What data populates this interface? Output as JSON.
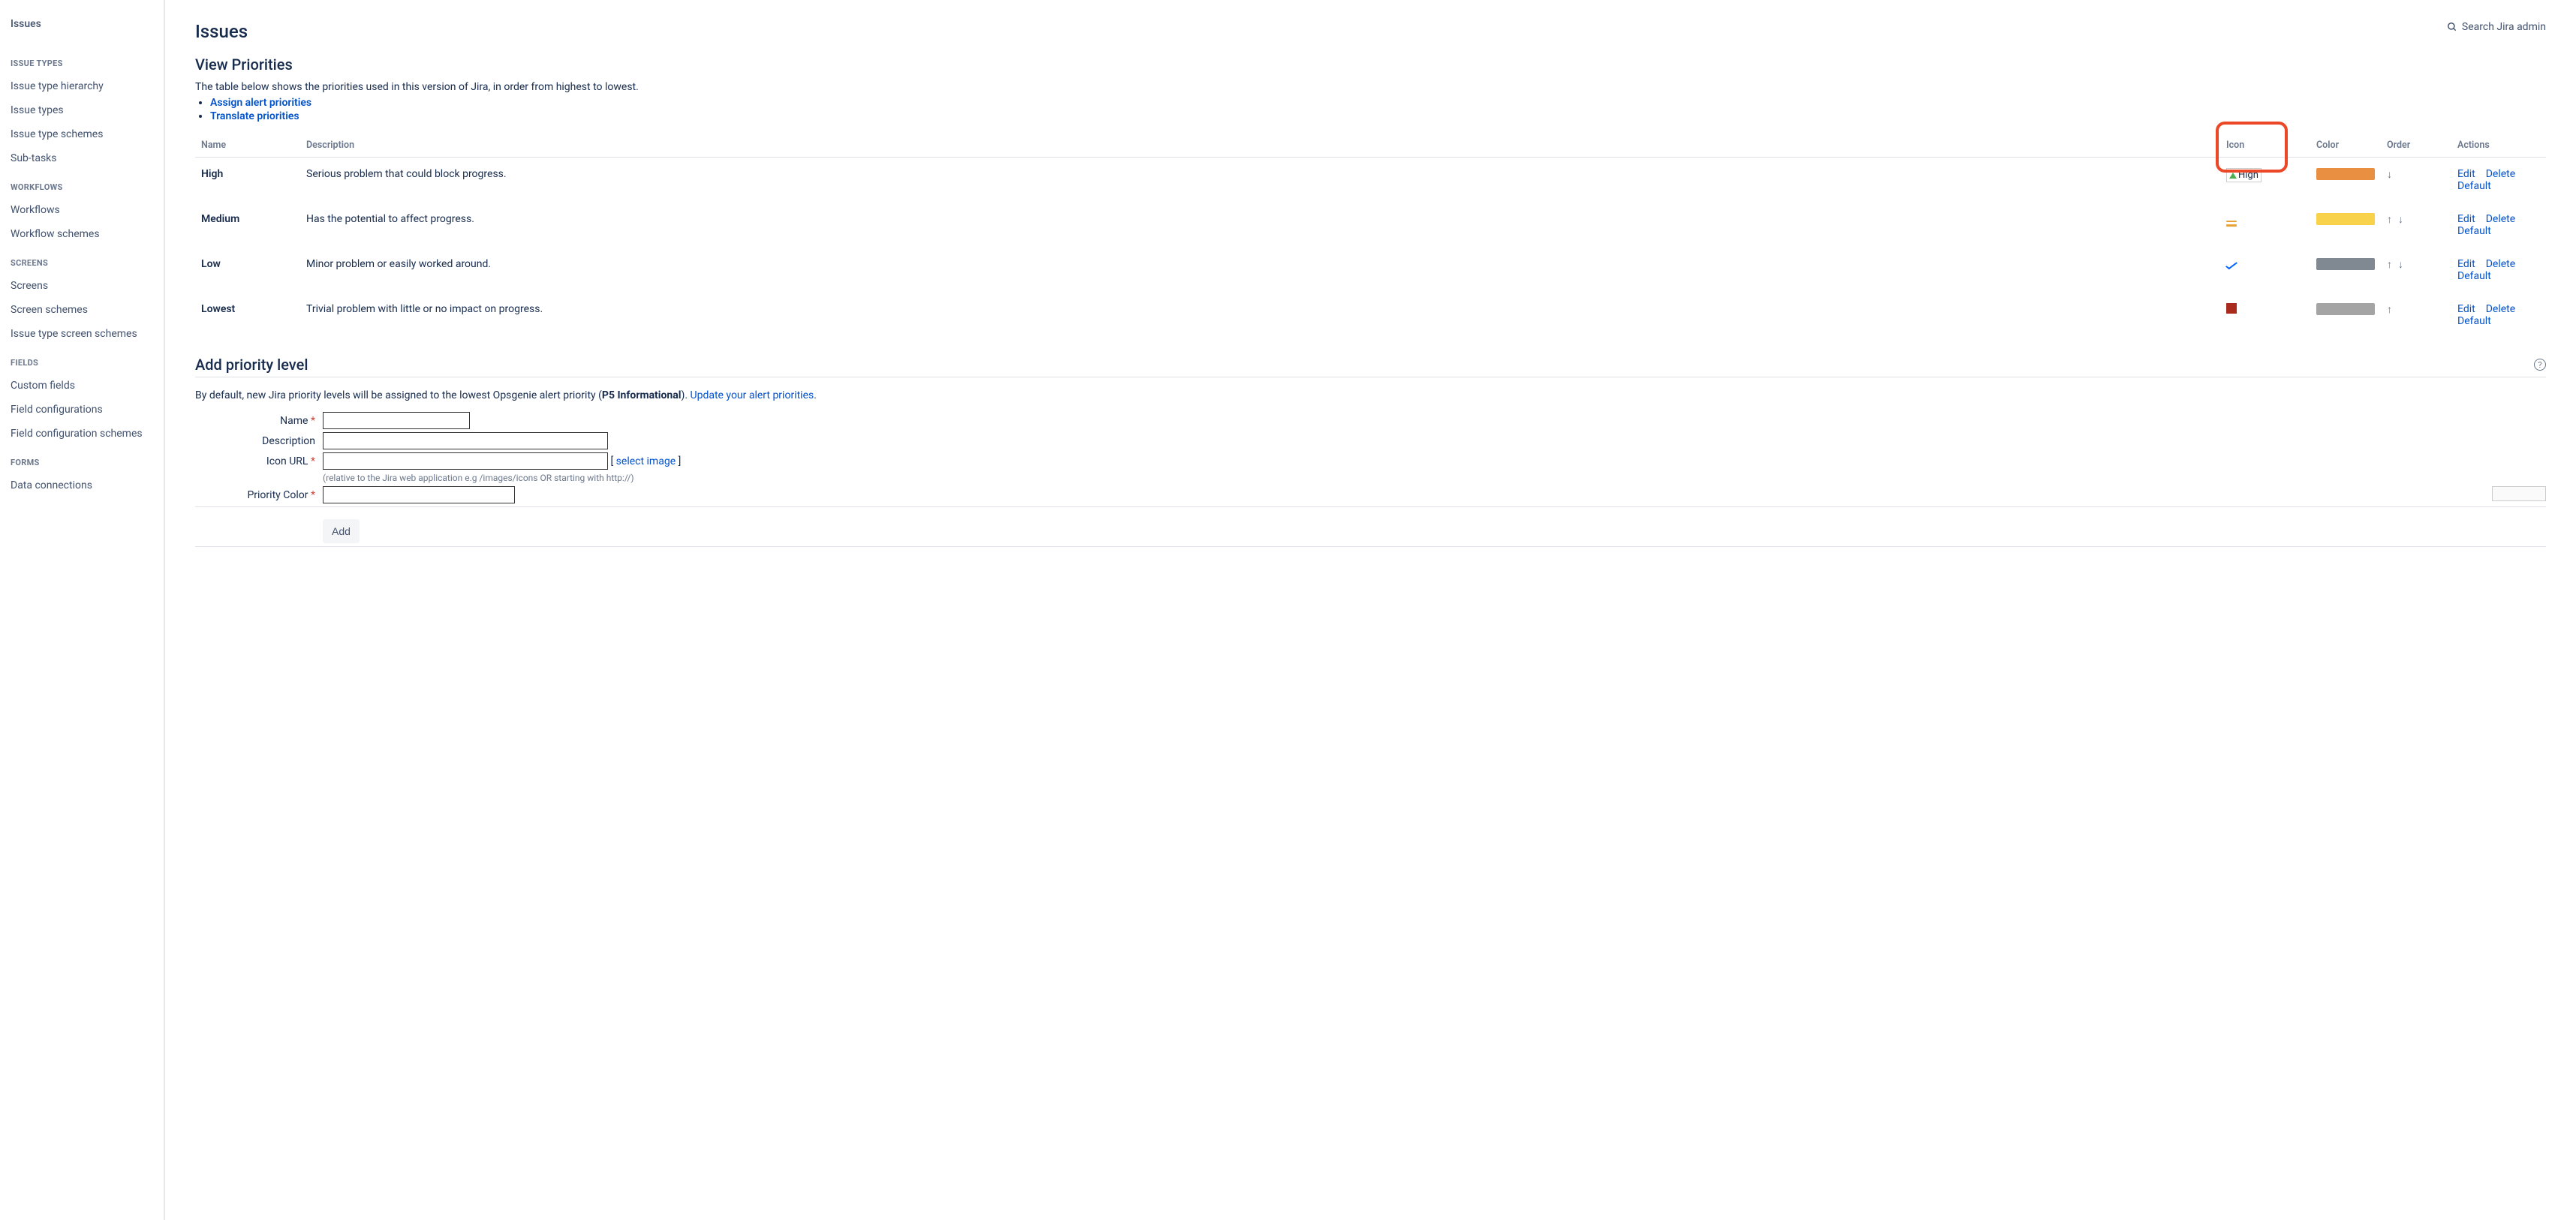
{
  "sidebar": {
    "top": "Issues",
    "groups": [
      {
        "label": "ISSUE TYPES",
        "items": [
          "Issue type hierarchy",
          "Issue types",
          "Issue type schemes",
          "Sub-tasks"
        ]
      },
      {
        "label": "WORKFLOWS",
        "items": [
          "Workflows",
          "Workflow schemes"
        ]
      },
      {
        "label": "SCREENS",
        "items": [
          "Screens",
          "Screen schemes",
          "Issue type screen schemes"
        ]
      },
      {
        "label": "FIELDS",
        "items": [
          "Custom fields",
          "Field configurations",
          "Field configuration schemes"
        ]
      },
      {
        "label": "FORMS",
        "items": [
          "Data connections"
        ]
      }
    ]
  },
  "search_placeholder": "Search Jira admin",
  "page_title": "Issues",
  "view": {
    "heading": "View Priorities",
    "desc": "The table below shows the priorities used in this version of Jira, in order from highest to lowest.",
    "links": [
      "Assign alert priorities",
      "Translate priorities"
    ]
  },
  "table": {
    "headers": {
      "name": "Name",
      "description": "Description",
      "icon": "Icon",
      "color": "Color",
      "order": "Order",
      "actions": "Actions"
    },
    "rows": [
      {
        "name": "High",
        "desc": "Serious problem that could block progress.",
        "color": "#E98F42",
        "actions": [
          "Edit",
          "Delete",
          "Default"
        ],
        "order": [
          "down"
        ],
        "broken_label": "High"
      },
      {
        "name": "Medium",
        "desc": "Has the potential to affect progress.",
        "color": "#F8D24B",
        "actions": [
          "Edit",
          "Delete",
          "Default"
        ],
        "order": [
          "up",
          "down"
        ]
      },
      {
        "name": "Low",
        "desc": "Minor problem or easily worked around.",
        "color": "#808891",
        "actions": [
          "Edit",
          "Delete",
          "Default"
        ],
        "order": [
          "up",
          "down"
        ]
      },
      {
        "name": "Lowest",
        "desc": "Trivial problem with little or no impact on progress.",
        "color": "#A4A4A4",
        "actions": [
          "Edit",
          "Delete",
          "Default"
        ],
        "order": [
          "up"
        ]
      }
    ]
  },
  "form": {
    "heading": "Add priority level",
    "note_pre": "By default, new Jira priority levels will be assigned to the lowest Opsgenie alert priority (",
    "note_bold": "P5 Informational",
    "note_post": "). ",
    "note_link": "Update your alert priorities",
    "note_end": ".",
    "labels": {
      "name": "Name",
      "desc": "Description",
      "icon": "Icon URL",
      "color": "Priority Color"
    },
    "select_image_pre": "[ ",
    "select_image": "select image",
    "select_image_post": " ]",
    "hint": "(relative to the Jira web application e.g /images/icons OR starting with http://)",
    "submit": "Add"
  }
}
